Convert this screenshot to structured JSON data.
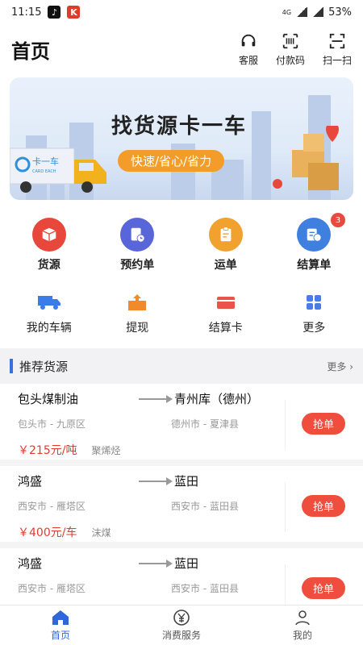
{
  "status": {
    "time": "11:15",
    "network": "4G",
    "battery": "53%"
  },
  "header": {
    "title": "首页",
    "actions": [
      {
        "label": "客服",
        "icon": "headset-icon"
      },
      {
        "label": "付款码",
        "icon": "barcode-icon"
      },
      {
        "label": "扫一扫",
        "icon": "scan-icon"
      }
    ]
  },
  "banner": {
    "title": "找货源卡一车",
    "subtitle": "快速/省心/省力",
    "truck_brand": "卡一车",
    "truck_brand_en": "CARD EACH"
  },
  "primary_grid": [
    {
      "label": "货源",
      "icon": "box-icon",
      "color": "#e8483c"
    },
    {
      "label": "预约单",
      "icon": "document-clock-icon",
      "color": "#5866d9"
    },
    {
      "label": "运单",
      "icon": "clipboard-icon",
      "color": "#f0a12e"
    },
    {
      "label": "结算单",
      "icon": "checklist-yen-icon",
      "color": "#3f7fe0",
      "badge": "3"
    }
  ],
  "secondary_grid": [
    {
      "label": "我的车辆",
      "icon": "truck-icon",
      "color": "#3b7de8"
    },
    {
      "label": "提现",
      "icon": "withdraw-icon",
      "color": "#f08a2a"
    },
    {
      "label": "结算卡",
      "icon": "card-icon",
      "color": "#e6544a"
    },
    {
      "label": "更多",
      "icon": "grid-icon",
      "color": "#4a7be6"
    }
  ],
  "section": {
    "title": "推荐货源",
    "more": "更多"
  },
  "cards": [
    {
      "from": "包头煤制油",
      "to": "青州库（德州）",
      "from_sub": "包头市 - 九原区",
      "to_sub": "德州市 - 夏津县",
      "price": "￥215元/吨",
      "goods": "聚烯烃",
      "action": "抢单"
    },
    {
      "from": "鸿盛",
      "to": "蓝田",
      "from_sub": "西安市 - 雁塔区",
      "to_sub": "西安市 - 蓝田县",
      "price": "￥400元/车",
      "goods": "沫煤",
      "action": "抢单"
    },
    {
      "from": "鸿盛",
      "to": "蓝田",
      "from_sub": "西安市 - 雁塔区",
      "to_sub": "西安市 - 蓝田县",
      "price": "",
      "goods": "",
      "action": "抢单"
    }
  ],
  "tabbar": [
    {
      "label": "首页",
      "icon": "home-icon",
      "active": true
    },
    {
      "label": "消费服务",
      "icon": "yen-circle-icon",
      "active": false
    },
    {
      "label": "我的",
      "icon": "user-icon",
      "active": false
    }
  ]
}
